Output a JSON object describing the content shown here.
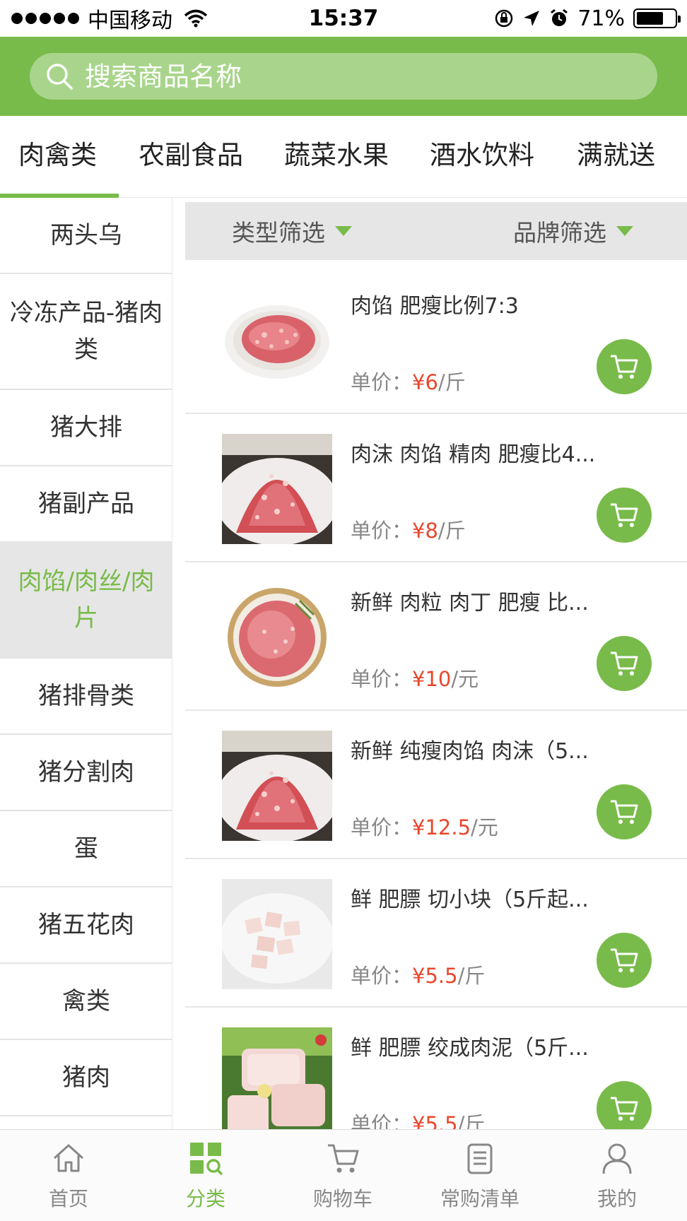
{
  "status_bar": {
    "carrier": "中国移动",
    "time": "15:37",
    "battery": "71%",
    "battery_level": 0.71,
    "icons": [
      "signal-dots-icon",
      "wifi-icon",
      "orientation-lock-icon",
      "location-arrow-icon",
      "alarm-icon",
      "battery-icon"
    ]
  },
  "search": {
    "placeholder": "搜索商品名称",
    "icon": "search-icon"
  },
  "top_tabs": [
    {
      "label": "肉禽类",
      "active": true
    },
    {
      "label": "农副食品",
      "active": false
    },
    {
      "label": "蔬菜水果",
      "active": false
    },
    {
      "label": "酒水饮料",
      "active": false
    },
    {
      "label": "满就送",
      "active": false
    }
  ],
  "sidebar": {
    "items": [
      {
        "label": "两头乌",
        "active": false
      },
      {
        "label": "冷冻产品-猪肉类",
        "active": false
      },
      {
        "label": "猪大排",
        "active": false
      },
      {
        "label": "猪副产品",
        "active": false
      },
      {
        "label": "肉馅/肉丝/肉片",
        "active": true
      },
      {
        "label": "猪排骨类",
        "active": false
      },
      {
        "label": "猪分割肉",
        "active": false
      },
      {
        "label": "蛋",
        "active": false
      },
      {
        "label": "猪五花肉",
        "active": false
      },
      {
        "label": "禽类",
        "active": false
      },
      {
        "label": "猪肉",
        "active": false
      }
    ]
  },
  "filters": {
    "type_label": "类型筛选",
    "brand_label": "品牌筛选"
  },
  "products": [
    {
      "name": "肉馅 肥瘦比例7:3",
      "price_prefix": "单价：",
      "price": "¥6",
      "unit": "/斤",
      "image": "minced-pork-plate"
    },
    {
      "name": "肉沫 肉馅 精肉 肥瘦比4...",
      "price_prefix": "单价：",
      "price": "¥8",
      "unit": "/斤",
      "image": "minced-pork-pile"
    },
    {
      "name": "新鲜 肉粒 肉丁 肥瘦 比...",
      "price_prefix": "单价：",
      "price": "¥10",
      "unit": "/元",
      "image": "diced-pork-basket"
    },
    {
      "name": "新鲜 纯瘦肉馅 肉沫（5...",
      "price_prefix": "单价：",
      "price": "¥12.5",
      "unit": "/元",
      "image": "minced-pork-pile"
    },
    {
      "name": "鲜 肥膘 切小块（5斤起...",
      "price_prefix": "单价：",
      "price": "¥5.5",
      "unit": "/斤",
      "image": "pork-fat-cubes"
    },
    {
      "name": "鲜 肥膘 绞成肉泥（5斤...",
      "price_prefix": "单价：",
      "price": "¥5.5",
      "unit": "/斤",
      "image": "pork-fat-slabs"
    }
  ],
  "bottom_nav": [
    {
      "label": "首页",
      "icon": "home-icon",
      "active": false
    },
    {
      "label": "分类",
      "icon": "category-icon",
      "active": true
    },
    {
      "label": "购物车",
      "icon": "cart-icon",
      "active": false
    },
    {
      "label": "常购清单",
      "icon": "list-icon",
      "active": false
    },
    {
      "label": "我的",
      "icon": "profile-icon",
      "active": false
    }
  ],
  "colors": {
    "brand_green": "#79bb4a",
    "search_bg": "#a8d58b",
    "price_red": "#e8472c",
    "active_sidebar_bg": "#e6e6e6"
  }
}
